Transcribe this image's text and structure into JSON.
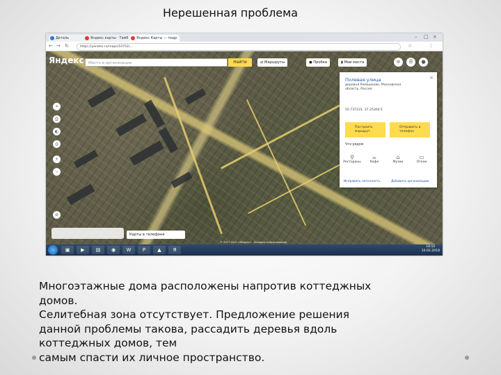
{
  "slide": {
    "title": "Нерешенная проблема",
    "description_lines": [
      "Многоэтажные дома расположены напротив коттеджных",
      "домов.",
      "Селитебная зона отсутствует. Предложение решения",
      "данной  проблемы такова, рассадить деревья вдоль",
      "коттеджных домов, тем",
      "самым спасти их личное пространство."
    ]
  },
  "browser": {
    "tabs": [
      {
        "label": "Деталь",
        "color": "#2b7bd8"
      },
      {
        "label": "Яндекс.карты · Тамб",
        "color": "#e03b2e"
      },
      {
        "label": "Яндекс.Карты — подр",
        "color": "#e03b2e"
      }
    ],
    "url": "https://yandex.ru/maps/10752/..."
  },
  "map": {
    "logo": "Яндекс",
    "search_placeholder": "Место и организации",
    "search_button": "Найти",
    "buttons": {
      "routes": "Маршруты",
      "traffic": "Пробки",
      "my_places": "Мои места"
    },
    "layers_button": "Карты в телефоне",
    "copyright": "© 2017 ООО «Яндекс» · Условия использования"
  },
  "card": {
    "title": "Полевая улица",
    "address": "деревня Ромашково, Московская область, Россия",
    "coords": "55.737231, 37.25364 E",
    "route_button": "Построить маршрут",
    "send_button": "Отправить в телефон",
    "nearby": "Что рядом",
    "categories": [
      "Рестораны",
      "Кафе",
      "Музеи",
      "Отели"
    ],
    "link_left": "Исправить неточность",
    "link_right": "Добавить организацию"
  },
  "taskbar": {
    "time": "18:55",
    "date": "10.02.2018"
  }
}
